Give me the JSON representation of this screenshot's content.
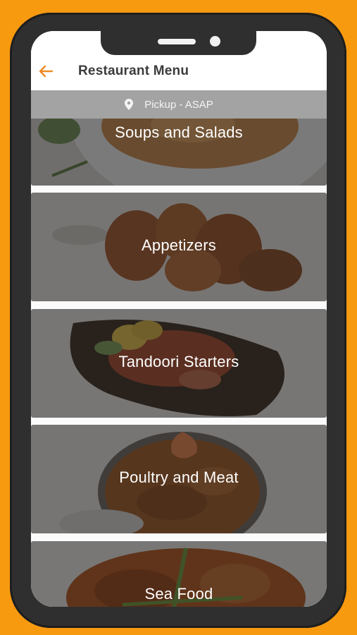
{
  "header": {
    "title": "Restaurant Menu",
    "back_icon": "arrow-left-icon",
    "accent_color": "#f08a24"
  },
  "pickup_bar": {
    "icon": "map-pin-icon",
    "text": "Pickup - ASAP"
  },
  "categories": [
    {
      "label": "Soups and Salads"
    },
    {
      "label": "Appetizers"
    },
    {
      "label": "Tandoori Starters"
    },
    {
      "label": "Poultry and Meat"
    },
    {
      "label": "Sea Food"
    }
  ],
  "theme": {
    "background": "#f89a10",
    "phone_frame": "#2f2f2f",
    "pickup_bar_bg": "#a3a3a3"
  }
}
